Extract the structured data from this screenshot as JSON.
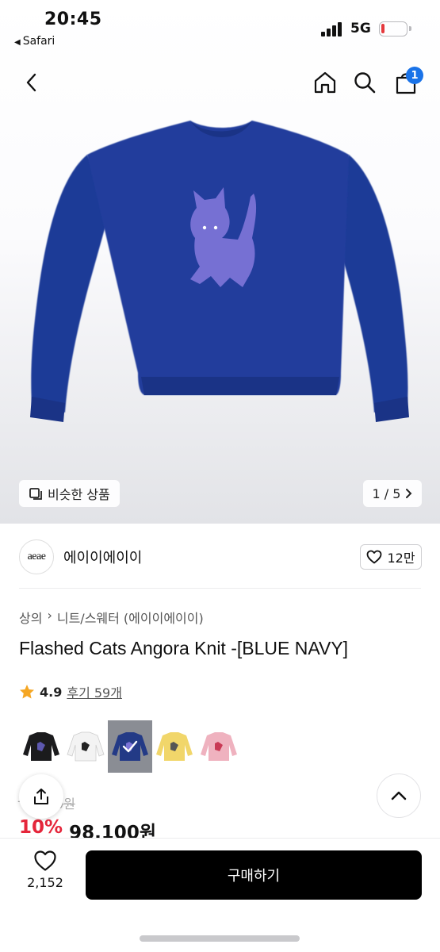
{
  "status_bar": {
    "time": "20:45",
    "back_app": "Safari",
    "network": "5G"
  },
  "nav": {
    "cart_count": "1"
  },
  "gallery": {
    "similar_label": "비슷한 상품",
    "pager": "1 / 5"
  },
  "brand": {
    "logo_text": "aeae",
    "name": "에이이에이이",
    "likes": "12만"
  },
  "breadcrumb": [
    "상의",
    "니트/스웨터 (에이이에이이)"
  ],
  "product": {
    "title": "Flashed Cats Angora Knit -[BLUE NAVY]",
    "rating": "4.9",
    "reviews": "후기 59개",
    "original_price": "0원",
    "original_price_prefix": "-",
    "discount": "10%",
    "sale_price": "98,100원"
  },
  "swatches": [
    {
      "color": "black",
      "hex": "#1b1b1d"
    },
    {
      "color": "white",
      "hex": "#f3f3f3"
    },
    {
      "color": "navy",
      "hex": "#233a86",
      "selected": true
    },
    {
      "color": "yellow",
      "hex": "#f1d66a"
    },
    {
      "color": "pink",
      "hex": "#efb2bf"
    }
  ],
  "bottom_bar": {
    "wish_count": "2,152",
    "buy_label": "구매하기"
  },
  "colors": {
    "accent_badge": "#1a73e8",
    "sale_red": "#e5263b",
    "sweater_navy": "#1f3b97",
    "cat_purple": "#7b73d6"
  },
  "icons": [
    "back-chevron-icon",
    "home-icon",
    "search-icon",
    "cart-icon",
    "similar-icon",
    "chevron-right-icon",
    "heart-icon",
    "star-icon",
    "share-icon",
    "chevron-up-icon",
    "check-icon"
  ]
}
